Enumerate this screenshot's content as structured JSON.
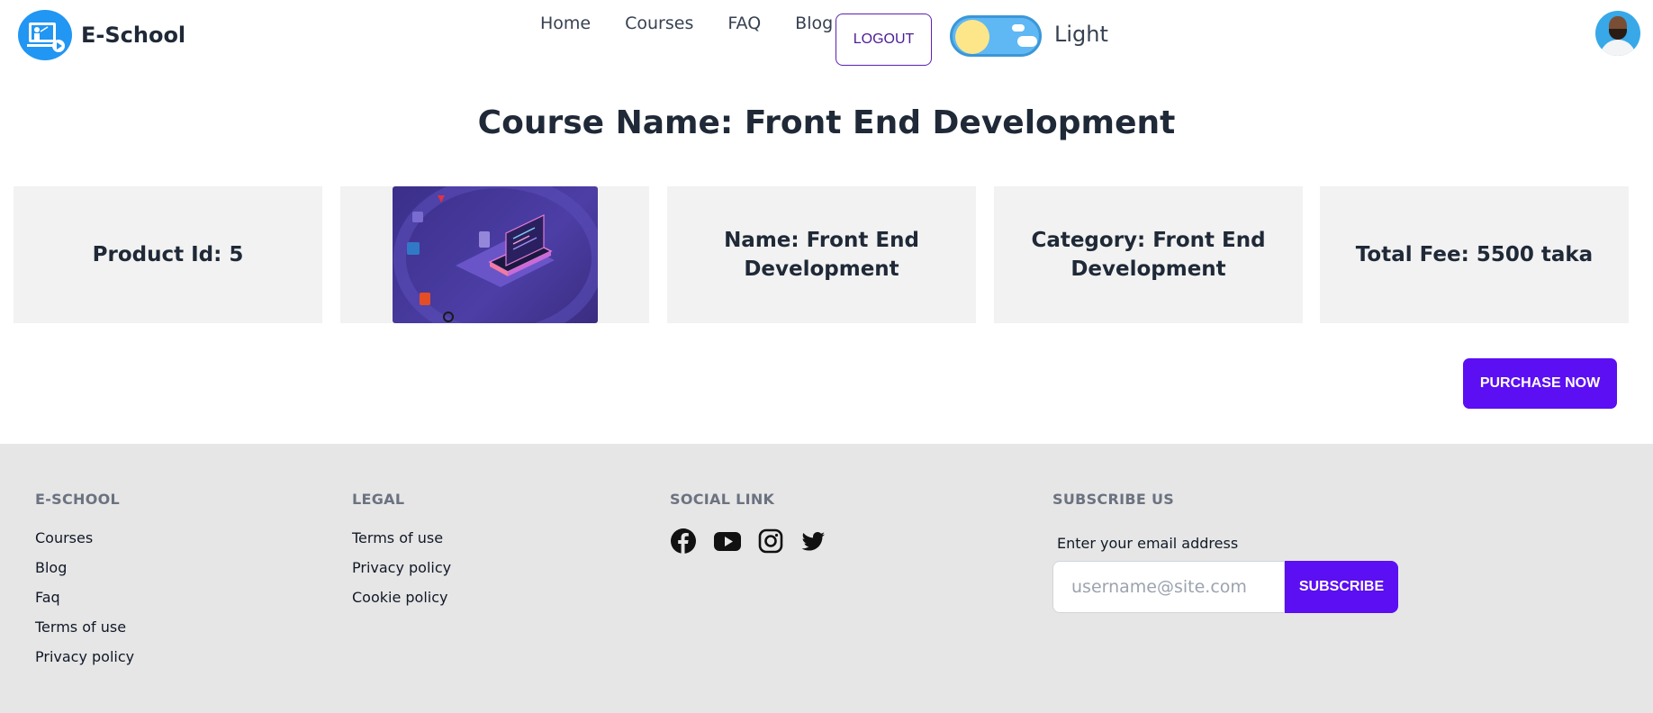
{
  "header": {
    "brand": "E-School",
    "nav": [
      {
        "label": "Home"
      },
      {
        "label": "Courses"
      },
      {
        "label": "FAQ"
      },
      {
        "label": "Blog"
      }
    ],
    "logout_label": "LOGOUT",
    "theme_label": "Light"
  },
  "course": {
    "title": "Course Name: Front End Development",
    "product_id": "Product Id: 5",
    "name": "Name: Front End Development",
    "category": "Category: Front End Development",
    "fee": "Total Fee: 5500 taka",
    "purchase_label": "PURCHASE NOW"
  },
  "footer": {
    "col1": {
      "heading": "E-SCHOOL",
      "links": [
        "Courses",
        "Blog",
        "Faq",
        "Terms of use",
        "Privacy policy"
      ]
    },
    "col2": {
      "heading": "LEGAL",
      "links": [
        "Terms of use",
        "Privacy policy",
        "Cookie policy"
      ]
    },
    "col3": {
      "heading": "SOCIAL LINK",
      "icons": [
        "facebook-icon",
        "youtube-icon",
        "instagram-icon",
        "twitter-icon"
      ]
    },
    "subscribe": {
      "heading": "SUBSCRIBE US",
      "label": "Enter your email address",
      "placeholder": "username@site.com",
      "button": "SUBSCRIBE"
    }
  },
  "colors": {
    "accent": "#5b0ff2",
    "footer_bg": "#e6e6e6",
    "card_bg": "#f2f2f2"
  }
}
